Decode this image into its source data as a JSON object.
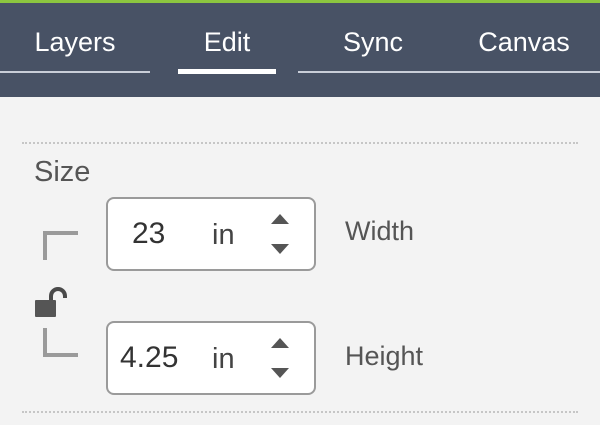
{
  "tabs": [
    {
      "id": "layers",
      "label": "Layers"
    },
    {
      "id": "edit",
      "label": "Edit",
      "active": true
    },
    {
      "id": "sync",
      "label": "Sync"
    },
    {
      "id": "canvas",
      "label": "Canvas"
    }
  ],
  "size": {
    "section_label": "Size",
    "lock_state": "unlocked",
    "width": {
      "value": "23",
      "unit": "in",
      "label": "Width"
    },
    "height": {
      "value": "4.25",
      "unit": "in",
      "label": "Height"
    }
  },
  "colors": {
    "accent": "#8cc63f",
    "tabbar": "#485265",
    "panel_bg": "#f3f3f3"
  },
  "icons": {
    "lock": "padlock-open-icon",
    "up": "chevron-up-icon",
    "down": "chevron-down-icon"
  }
}
